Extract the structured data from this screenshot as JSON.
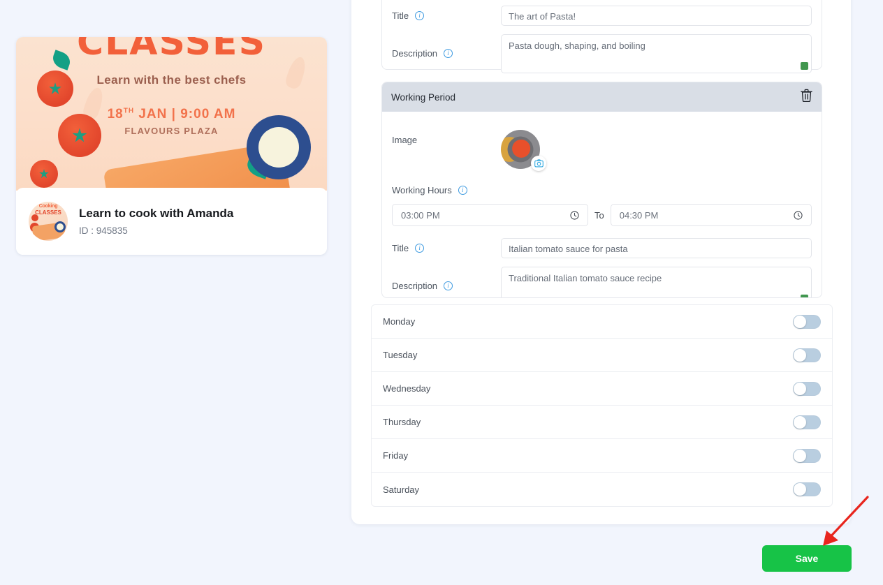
{
  "colors": {
    "page_bg": "#f2f5fd",
    "panel_bg": "#ffffff",
    "card_header_bg": "#d9dee6",
    "accent_green": "#17c347",
    "resize_grip_green": "#41974f",
    "toggle_off_track": "#b9cee0",
    "info_icon_blue": "#3d9ae0",
    "annotation_red": "#e8251e"
  },
  "preview_card": {
    "banner": {
      "title": "CLASSES",
      "subtitle": "Learn with the best chefs",
      "date": "18",
      "date_suffix": "TH",
      "date_rest": " JAN | 9:00 AM",
      "venue": "FLAVOURS PLAZA"
    },
    "avatar": {
      "line1": "Cooking",
      "line2": "CLASSES"
    },
    "title": "Learn to cook with Amanda",
    "id_text": "ID : 945835"
  },
  "top_card": {
    "title_label": "Title",
    "title_value": "The art of Pasta!",
    "description_label": "Description",
    "description_value": "Pasta dough, shaping, and boiling"
  },
  "working_period": {
    "header": "Working Period",
    "delete_icon": "trash-icon",
    "image_label": "Image",
    "image_badge_icon": "camera-icon",
    "hours_label": "Working Hours",
    "from_value": "03:00  PM",
    "to_label": "To",
    "to_value": "04:30  PM",
    "clock_icon": "clock-icon",
    "title_label": "Title",
    "title_value": "Italian tomato sauce for pasta",
    "description_label": "Description",
    "description_value": "Traditional Italian tomato sauce recipe"
  },
  "weekdays": [
    {
      "name": "Monday",
      "enabled": false
    },
    {
      "name": "Tuesday",
      "enabled": false
    },
    {
      "name": "Wednesday",
      "enabled": false
    },
    {
      "name": "Thursday",
      "enabled": false
    },
    {
      "name": "Friday",
      "enabled": false
    },
    {
      "name": "Saturday",
      "enabled": false
    }
  ],
  "footer": {
    "save_label": "Save"
  }
}
